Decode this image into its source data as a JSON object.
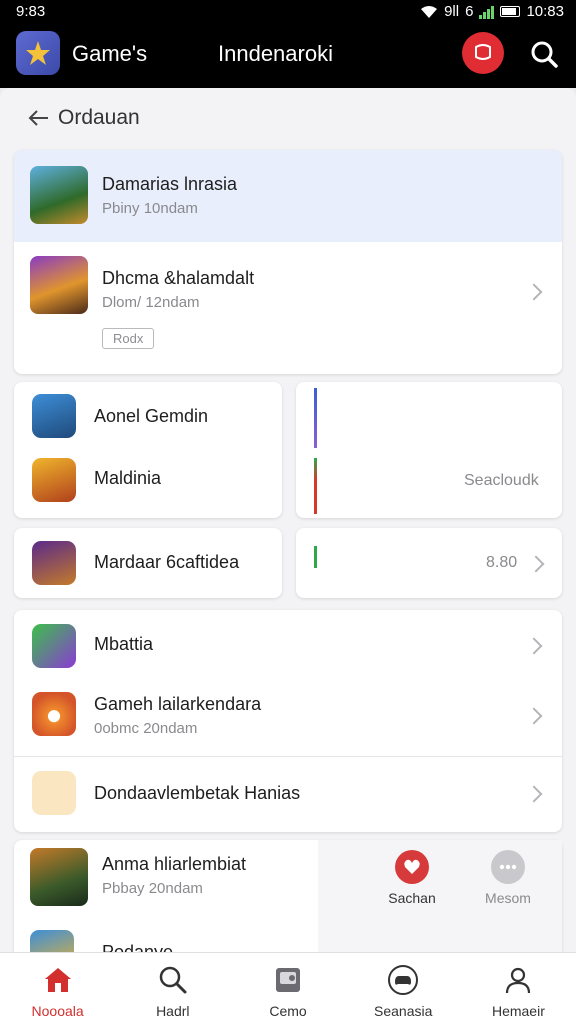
{
  "status_bar": {
    "time": "9:83",
    "network": "9ll",
    "extra": "6",
    "clock": "10:83"
  },
  "app_bar": {
    "app_name": "Game's",
    "title": "Inndenaroki",
    "notif_label": "Q!"
  },
  "back": {
    "label": "Ordauan"
  },
  "featured": [
    {
      "title": "Damarias lnrasia",
      "subtitle": "Pbiny 10ndam"
    },
    {
      "title": "Dhcma &halamdalt",
      "subtitle": "Dlom/ 12ndam",
      "tag": "Rodx"
    }
  ],
  "grid": {
    "left_card": [
      {
        "title": "Aonel Gemdin"
      },
      {
        "title": "Maldinia"
      }
    ],
    "right_card": {
      "label": "Seacloudk"
    },
    "left_card2": {
      "title": "Mardaar 6caftidea"
    },
    "right_card2": {
      "value": "8.80"
    }
  },
  "list": [
    {
      "title": "Mbattia",
      "subtitle": ""
    },
    {
      "title": "Gameh lailarkendara",
      "subtitle": "0obmc 20ndam"
    },
    {
      "title": "Dondaavlembetak Hanias",
      "subtitle": ""
    }
  ],
  "bottom_card": {
    "items": [
      {
        "title": "Anma hliarlembiat",
        "subtitle": "Pbbay 20ndam"
      },
      {
        "title": "Podanye",
        "subtitle": ""
      }
    ],
    "actions": [
      {
        "label": "Sachan"
      },
      {
        "label": "Mesom"
      }
    ]
  },
  "bottom_nav": [
    {
      "label": "Noooala",
      "icon": "home-icon",
      "active": true
    },
    {
      "label": "Hadrl",
      "icon": "search-icon",
      "active": false
    },
    {
      "label": "Cemo",
      "icon": "folder-icon",
      "active": false
    },
    {
      "label": "Seanasia",
      "icon": "controller-icon",
      "active": false
    },
    {
      "label": "Hemaeir",
      "icon": "profile-icon",
      "active": false
    }
  ],
  "colors": {
    "accent": "#d32f2f",
    "highlight": "#e8eefc",
    "logo": "#4b58c3"
  }
}
